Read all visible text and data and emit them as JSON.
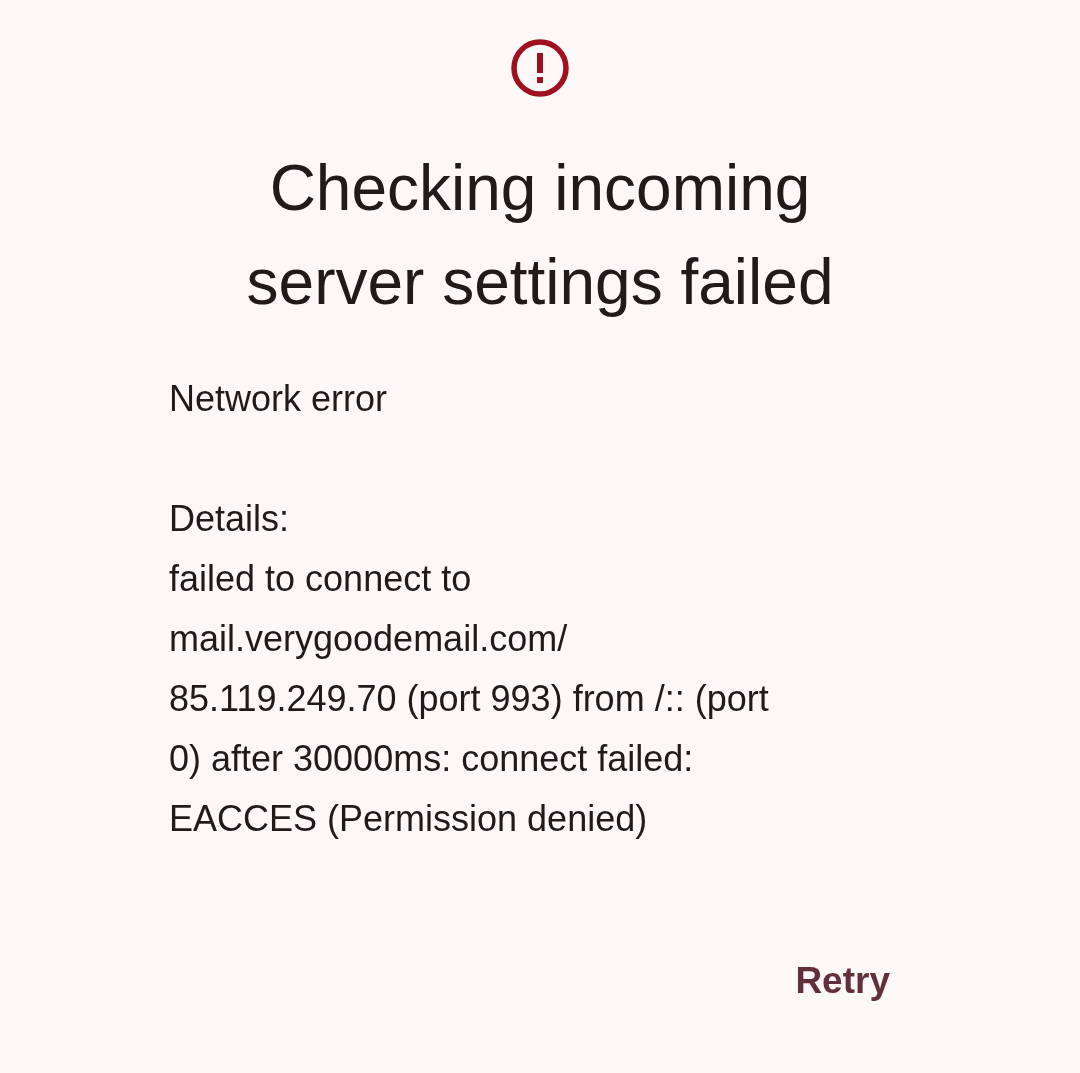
{
  "dialog": {
    "title": "Checking incoming server settings failed",
    "message": "Network error",
    "details_label": "Details:",
    "details_lines": [
      "failed to connect to",
      "mail.verygoodemail.com/",
      "85.119.249.70 (port 993) from /:: (port",
      "0) after 30000ms: connect failed:",
      "EACCES (Permission denied)"
    ],
    "buttons": [
      {
        "label": "Retry"
      }
    ]
  }
}
